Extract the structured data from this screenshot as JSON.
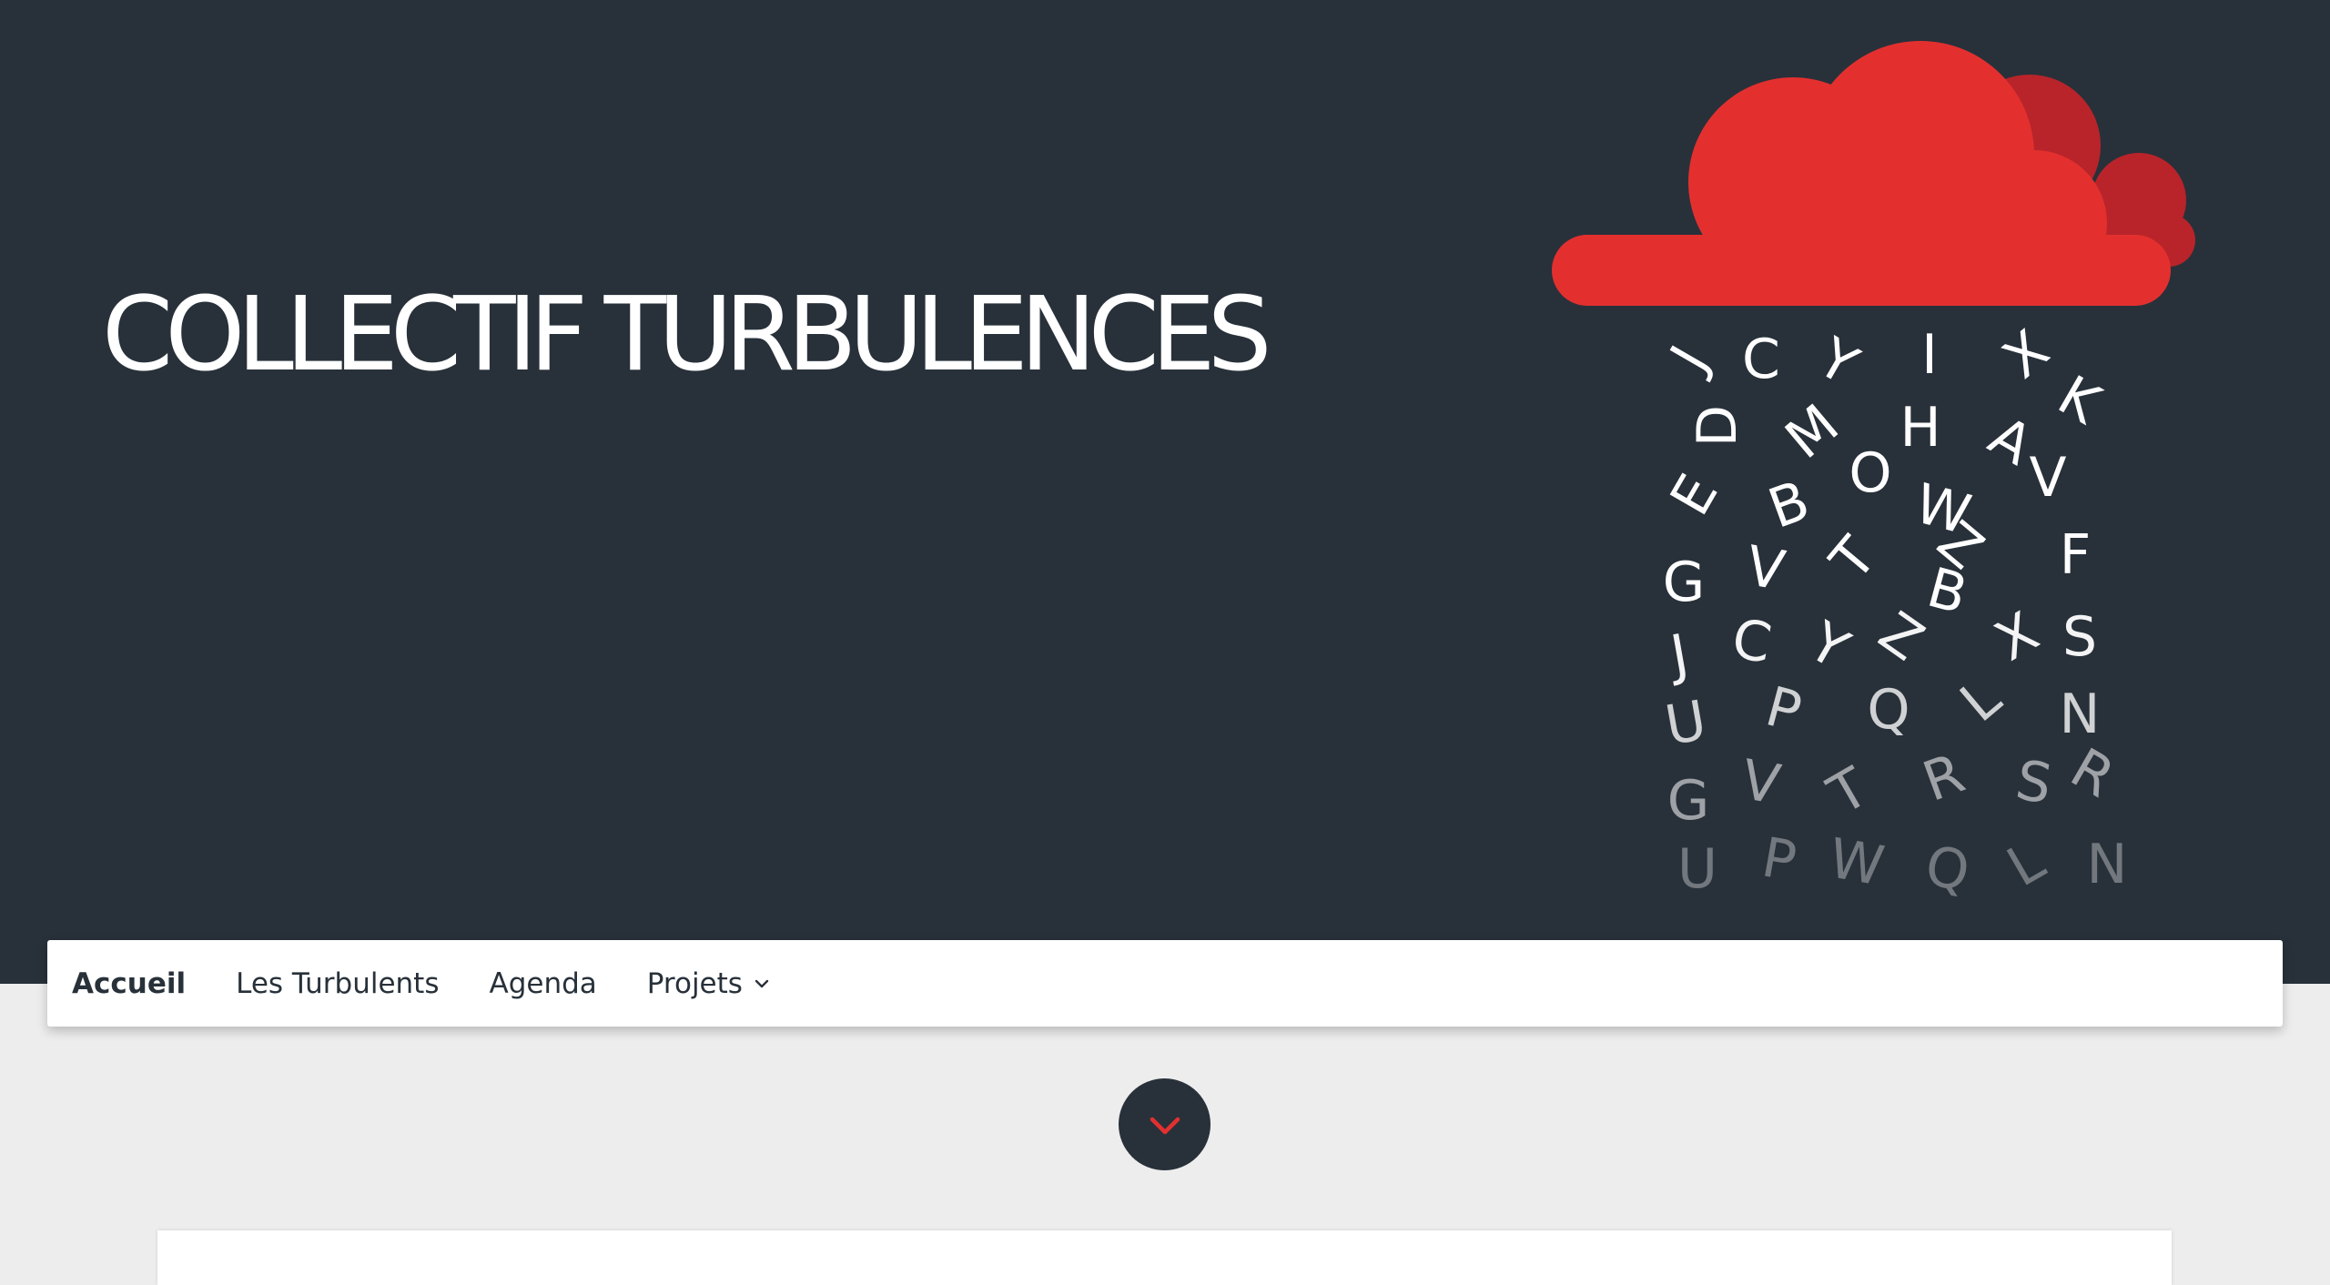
{
  "site": {
    "title": "COLLECTIF TURBULENCES"
  },
  "logo": {
    "icon": "cloud-raining-letters-logo",
    "cloud_color": "#e3302f",
    "cloud_shadow_color": "#b8242a",
    "letters": [
      "J",
      "C",
      "Y",
      "I",
      "X",
      "K",
      "D",
      "M",
      "H",
      "A",
      "O",
      "E",
      "B",
      "W",
      "V",
      "G",
      "V",
      "T",
      "Z",
      "F",
      "B",
      "J",
      "C",
      "Y",
      "Z",
      "X",
      "S",
      "U",
      "P",
      "Q",
      "L",
      "N",
      "G",
      "V",
      "T",
      "R",
      "S",
      "R",
      "U",
      "P",
      "W",
      "Q",
      "L",
      "N"
    ]
  },
  "nav": {
    "items": [
      {
        "label": "Accueil",
        "active": true
      },
      {
        "label": "Les Turbulents",
        "active": false
      },
      {
        "label": "Agenda",
        "active": false
      },
      {
        "label": "Projets",
        "active": false,
        "has_dropdown": true
      }
    ]
  },
  "scroll_button": {
    "icon": "chevron-down-icon",
    "color": "#e3302f"
  },
  "colors": {
    "hero_bg": "#28313a",
    "page_bg": "#ededed",
    "accent": "#e3302f"
  }
}
